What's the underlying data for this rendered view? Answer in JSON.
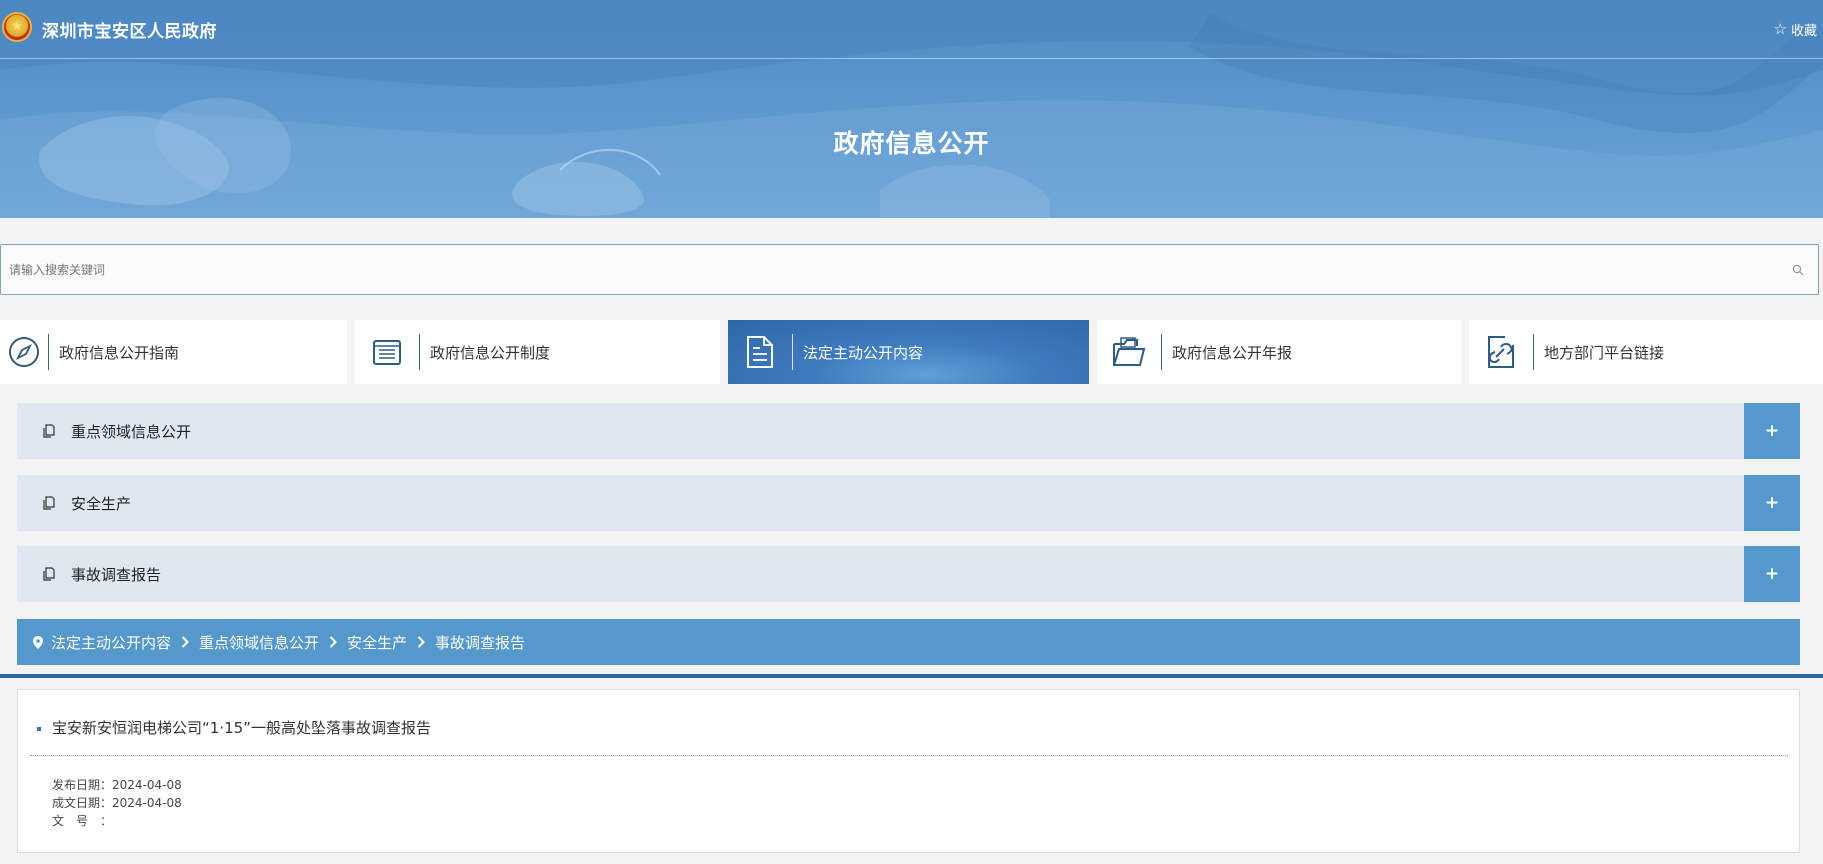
{
  "header": {
    "site_name": "深圳市宝安区人民政府",
    "favorite_label": "收藏",
    "page_heading": "政府信息公开"
  },
  "search": {
    "placeholder": "请输入搜索关键词"
  },
  "tabs": [
    {
      "label": "政府信息公开指南",
      "icon": "compass-icon",
      "active": false
    },
    {
      "label": "政府信息公开制度",
      "icon": "list-document-icon",
      "active": false
    },
    {
      "label": "法定主动公开内容",
      "icon": "document-icon",
      "active": true
    },
    {
      "label": "政府信息公开年报",
      "icon": "folder-icon",
      "active": false
    },
    {
      "label": "地方部门平台链接",
      "icon": "link-icon",
      "active": false
    }
  ],
  "accordion": [
    {
      "label": "重点领域信息公开",
      "toggle": "+"
    },
    {
      "label": "安全生产",
      "toggle": "+"
    },
    {
      "label": "事故调查报告",
      "toggle": "+"
    }
  ],
  "breadcrumb": [
    "法定主动公开内容",
    "重点领域信息公开",
    "安全生产",
    "事故调查报告"
  ],
  "article": {
    "title": "宝安新安恒润电梯公司“1·15”一般高处坠落事故调查报告",
    "publish_label": "发布日期：",
    "publish_date": "2024-04-08",
    "written_label": "成文日期：",
    "written_date": "2024-04-08",
    "docno_label": "文号：",
    "docno_value": ""
  },
  "colors": {
    "banner": "#5b96cd",
    "active_tab": "#2f66a8",
    "accordion_bg": "#dfe8f1",
    "accordion_toggle": "#5498cc",
    "breadcrumb_bg": "#5498cc"
  }
}
